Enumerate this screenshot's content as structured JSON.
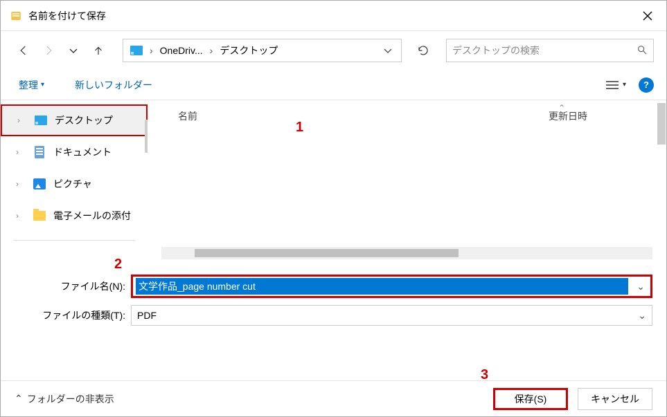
{
  "title": "名前を付けて保存",
  "nav": {
    "path": [
      "OneDriv...",
      "デスクトップ"
    ],
    "search_placeholder": "デスクトップの検索"
  },
  "toolbar": {
    "organize": "整理",
    "new_folder": "新しいフォルダー"
  },
  "tree": {
    "items": [
      {
        "label": "デスクトップ",
        "icon": "desktop",
        "selected": true
      },
      {
        "label": "ドキュメント",
        "icon": "doc",
        "selected": false
      },
      {
        "label": "ピクチャ",
        "icon": "pic",
        "selected": false
      },
      {
        "label": "電子メールの添付",
        "icon": "folder",
        "selected": false
      }
    ]
  },
  "list": {
    "columns": {
      "name": "名前",
      "date": "更新日時"
    }
  },
  "fields": {
    "filename_label": "ファイル名(N):",
    "filename_value": "文学作品_page number cut",
    "type_label": "ファイルの種類(T):",
    "type_value": "PDF"
  },
  "bottom": {
    "hide_folders": "フォルダーの非表示",
    "save": "保存(S)",
    "cancel": "キャンセル"
  },
  "annotations": {
    "a1": "1",
    "a2": "2",
    "a3": "3"
  }
}
